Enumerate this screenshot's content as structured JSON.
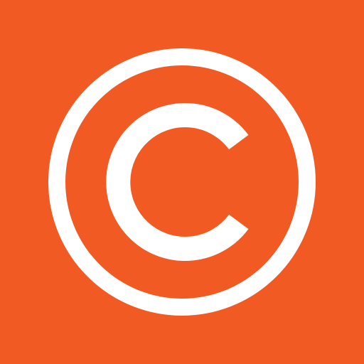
{
  "icon": {
    "name": "copyright-icon",
    "background_color": "#F15A22",
    "foreground_color": "#FFFFFF"
  }
}
